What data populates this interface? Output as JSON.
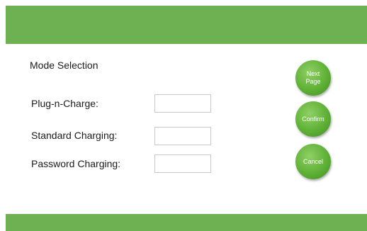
{
  "screen": {
    "title": "Mode Selection"
  },
  "fields": [
    {
      "label": "Plug-n-Charge:",
      "value": ""
    },
    {
      "label": "Standard Charging:",
      "value": ""
    },
    {
      "label": "Password Charging:",
      "value": ""
    }
  ],
  "buttons": {
    "next_page": "Next\nPage",
    "confirm": "Confirm",
    "cancel": "Cancel"
  },
  "colors": {
    "bar": "#6eb152",
    "button": "#5fb136"
  }
}
